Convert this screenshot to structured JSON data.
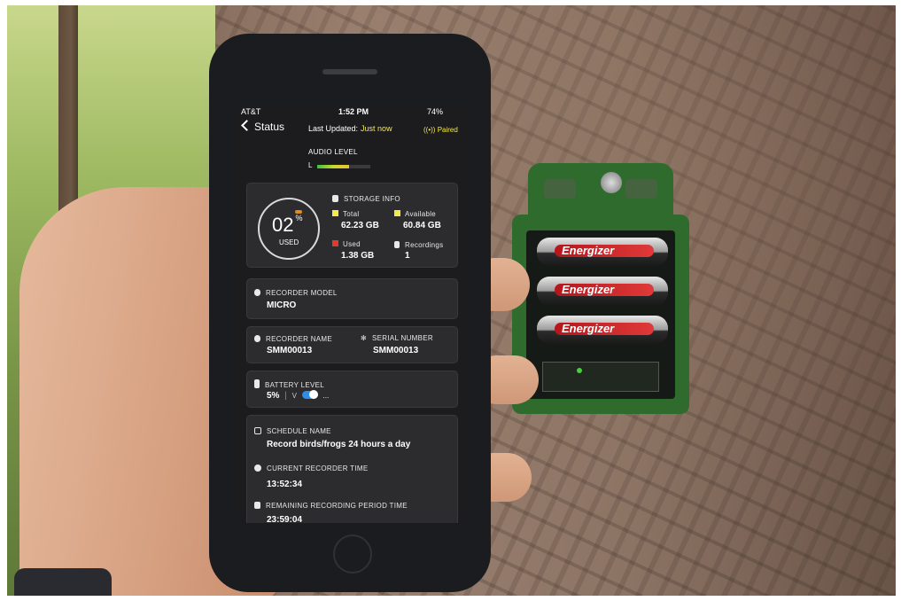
{
  "status_bar": {
    "carrier": "AT&T",
    "time": "1:52 PM",
    "battery": "74%"
  },
  "nav": {
    "back_label": "Status",
    "last_updated_label": "Last Updated:",
    "last_updated_value": "Just now",
    "paired": "Paired"
  },
  "audio": {
    "label": "AUDIO LEVEL",
    "channel": "L",
    "level_fraction": 0.6
  },
  "storage": {
    "percent": "02",
    "percent_sign": "%",
    "used_caption": "USED",
    "title": "STORAGE INFO",
    "total_label": "Total",
    "total_value": "62.23 GB",
    "available_label": "Available",
    "available_value": "60.84 GB",
    "used_label": "Used",
    "used_value": "1.38 GB",
    "recordings_label": "Recordings",
    "recordings_value": "1",
    "colors": {
      "total": "#f6e94a",
      "available": "#f6e94a",
      "used": "#e23b2e",
      "ring_accent": "#e28a1c"
    }
  },
  "recorder_model": {
    "label": "RECORDER MODEL",
    "value": "MICRO"
  },
  "recorder_name": {
    "label": "RECORDER NAME",
    "value": "SMM00013"
  },
  "serial_number": {
    "label": "SERIAL NUMBER",
    "value": "SMM00013"
  },
  "battery_level": {
    "label": "BATTERY LEVEL",
    "value": "5%",
    "separator": "V",
    "suffix": "..."
  },
  "schedule": {
    "label": "SCHEDULE NAME",
    "value": "Record birds/frogs 24 hours a day"
  },
  "current_time": {
    "label": "CURRENT RECORDER TIME",
    "value": "13:52:34"
  },
  "remaining": {
    "label": "REMAINING RECORDING PERIOD TIME",
    "value": "23:59:04"
  },
  "device_photo": {
    "battery_brand": "Energizer"
  },
  "colors": {
    "accent_yellow": "#f6e94a",
    "toggle_blue": "#2f8de8",
    "device_green": "#2f6b2c"
  }
}
